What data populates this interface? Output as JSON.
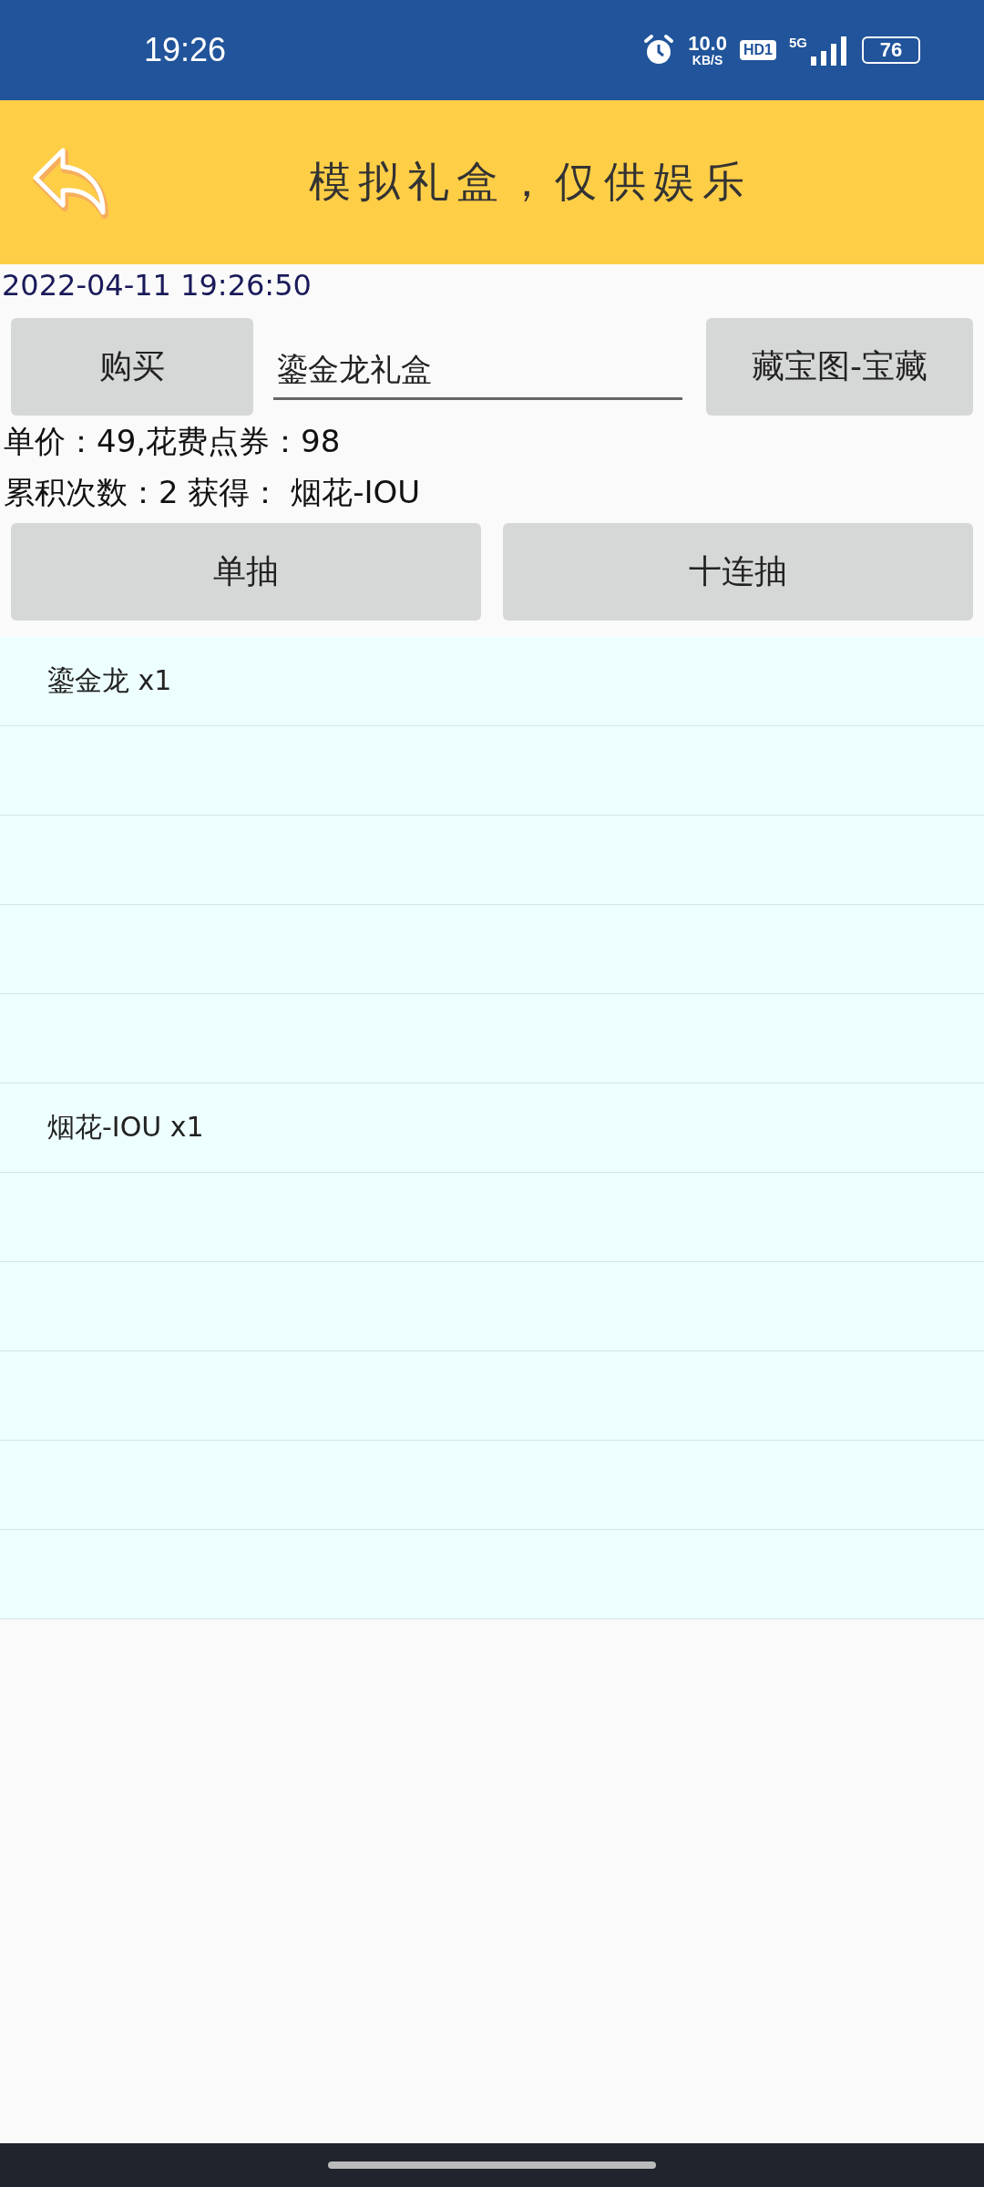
{
  "status_bar": {
    "time": "19:26",
    "net_speed": "10.0",
    "net_unit": "KB/S",
    "hd_badge": "HD1",
    "network": "5G",
    "battery": "76"
  },
  "header": {
    "title": "模拟礼盒，仅供娱乐"
  },
  "timestamp": "2022-04-11 19:26:50",
  "purchase": {
    "buy_button": "购买",
    "box_field": {
      "value": "鎏金龙礼盒"
    },
    "treasure_button": "藏宝图-宝藏"
  },
  "info_lines": [
    "单价：49,花费点券：98",
    "累积次数：2 获得： 烟花-IOU"
  ],
  "draw_buttons": [
    "单抽",
    "十连抽"
  ],
  "results": [
    {
      "kind": "item",
      "text": "鎏金龙 x1"
    },
    {
      "kind": "empty"
    },
    {
      "kind": "empty"
    },
    {
      "kind": "empty"
    },
    {
      "kind": "empty"
    },
    {
      "kind": "item",
      "text": "烟花-IOU x1"
    },
    {
      "kind": "empty"
    },
    {
      "kind": "empty"
    },
    {
      "kind": "empty"
    },
    {
      "kind": "empty"
    },
    {
      "kind": "empty"
    }
  ]
}
